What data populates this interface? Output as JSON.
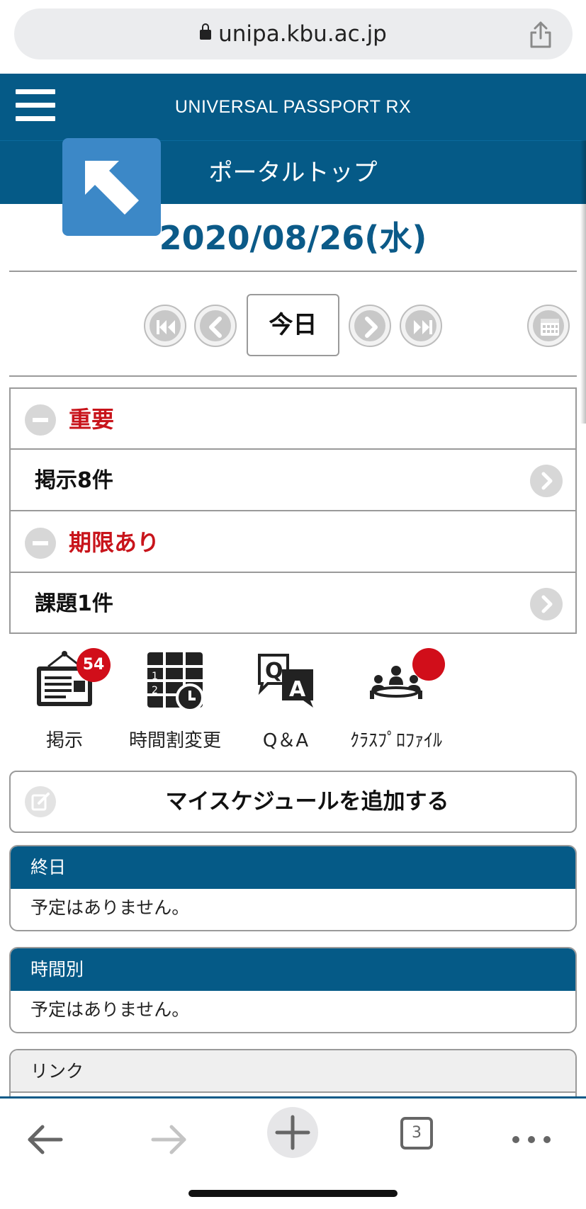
{
  "browser": {
    "url": "unipa.kbu.ac.jp",
    "tab_count": "3"
  },
  "header": {
    "app_title": "UNIVERSAL PASSPORT RX",
    "page_title": "ポータルトップ"
  },
  "date": {
    "current": "2020/08/26(水)",
    "today_label": "今日"
  },
  "info": {
    "important_label": "重要",
    "notices_label": "掲示8件",
    "deadline_label": "期限あり",
    "tasks_label": "課題1件"
  },
  "shortcuts": [
    {
      "label": "掲示",
      "badge": "54",
      "icon": "bulletin-board-icon"
    },
    {
      "label": "時間割変更",
      "icon": "timetable-change-icon"
    },
    {
      "label": "Q＆A",
      "icon": "qa-icon"
    },
    {
      "label": "ｸﾗｽﾌﾟﾛﾌｧｲﾙ",
      "badge": "",
      "icon": "class-profile-icon"
    }
  ],
  "schedule": {
    "add_label": "マイスケジュールを追加する",
    "allday_title": "終日",
    "allday_empty": "予定はありません。",
    "timed_title": "時間別",
    "timed_empty": "予定はありません。",
    "links_title": "リンク"
  },
  "colors": {
    "primary": "#055a87",
    "accent_tile": "#3c88c7",
    "alert_red": "#c8141b",
    "badge_red": "#d10e1a"
  }
}
